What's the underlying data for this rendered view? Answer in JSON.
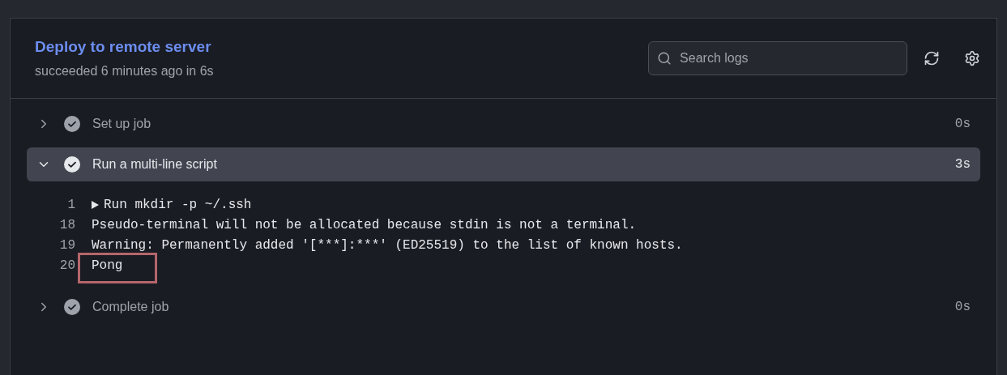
{
  "job": {
    "title": "Deploy to remote server",
    "status": "succeeded 6 minutes ago in 6s"
  },
  "search": {
    "placeholder": "Search logs"
  },
  "steps": [
    {
      "name": "Set up job",
      "duration": "0s",
      "expanded": false,
      "selected": false
    },
    {
      "name": "Run a multi-line script",
      "duration": "3s",
      "expanded": true,
      "selected": true,
      "log": [
        {
          "number": "1",
          "text": "Run mkdir -p ~/.ssh",
          "kind": "group",
          "highlighted": false
        },
        {
          "number": "18",
          "text": "Pseudo-terminal will not be allocated because stdin is not a terminal.",
          "kind": "line",
          "highlighted": false
        },
        {
          "number": "19",
          "text": "Warning: Permanently added '[***]:***' (ED25519) to the list of known hosts.",
          "kind": "line",
          "highlighted": false
        },
        {
          "number": "20",
          "text": "Pong",
          "kind": "line",
          "highlighted": true
        }
      ]
    },
    {
      "name": "Complete job",
      "duration": "0s",
      "expanded": false,
      "selected": false
    }
  ]
}
